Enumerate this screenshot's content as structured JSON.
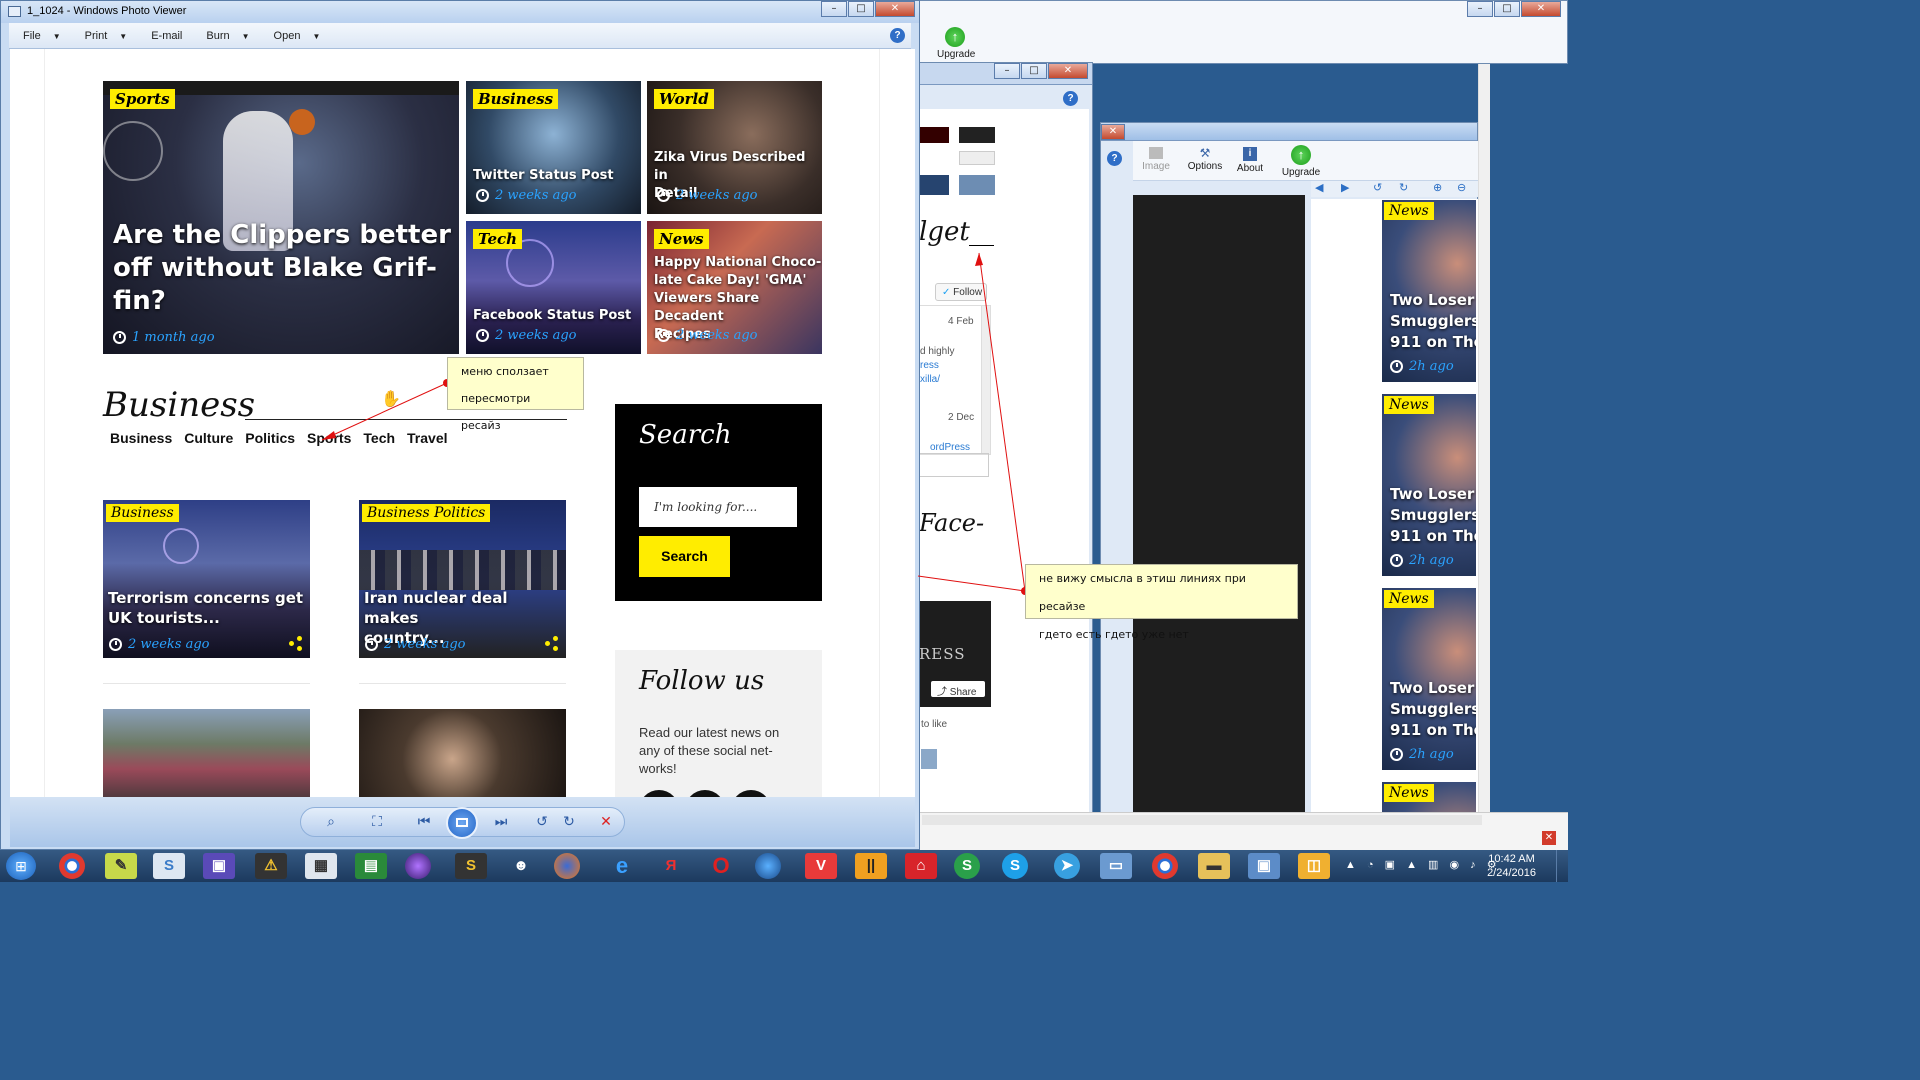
{
  "viewer": {
    "window_title": "1_1024 - Windows Photo Viewer",
    "menu": [
      {
        "label": "File"
      },
      {
        "label": "Print"
      },
      {
        "label": "E-mail"
      },
      {
        "label": "Burn"
      },
      {
        "label": "Open"
      }
    ]
  },
  "page": {
    "featured": {
      "tag": "Sports",
      "title_lines": [
        "Are the Clippers better",
        "off without Blake Grif-",
        "fin?"
      ],
      "time": "1 month ago"
    },
    "tiles": [
      {
        "tag": "Business",
        "title_lines": [
          "Twitter Status Post"
        ],
        "time": "2 weeks ago"
      },
      {
        "tag": "World",
        "title_lines": [
          "Zika Virus Described in",
          "Detail"
        ],
        "time": "2 weeks ago"
      },
      {
        "tag": "Tech",
        "title_lines": [
          "Facebook Status Post"
        ],
        "time": "2 weeks ago"
      },
      {
        "tag": "News",
        "title_lines": [
          "Happy National Choco-",
          "late Cake Day! 'GMA'",
          "Viewers Share Decadent",
          "Recipes"
        ],
        "time": "2 weeks ago"
      }
    ],
    "business_section": {
      "title": "Business",
      "nav": [
        "Business",
        "Culture",
        "Politics",
        "Sports",
        "Tech",
        "Travel"
      ]
    },
    "cards": [
      {
        "tags": [
          "Business"
        ],
        "title_lines": [
          "Terrorism concerns get",
          "UK tourists..."
        ],
        "time": "2 weeks ago"
      },
      {
        "tags": [
          "Business",
          "Politics"
        ],
        "title_lines": [
          "Iran nuclear deal makes",
          "country..."
        ],
        "time": "2 weeks ago"
      }
    ],
    "search": {
      "title": "Search",
      "placeholder": "I'm looking for....",
      "button": "Search"
    },
    "follow": {
      "title": "Follow us",
      "text_lines": [
        "Read our latest news on",
        "any of these social net-",
        "works!"
      ]
    }
  },
  "notes": {
    "note1_lines": [
      "меню сползает",
      "пересмотри ресайз"
    ],
    "note2_lines": [
      "не вижу смысла в этиш линиях при ресайзе",
      "гдето есть гдето уже нет"
    ]
  },
  "background_windows": {
    "upgrade_label": "Upgrade",
    "toolbar2": {
      "image": "Image",
      "options": "Options",
      "about": "About",
      "upgrade": "Upgrade"
    },
    "partial_texts": {
      "get": "lget",
      "face": "Face-",
      "follow_btn": "Follow",
      "date1": "4 Feb",
      "date2": "2 Dec",
      "highly": "d highly",
      "ress": "ress",
      "xilla": "xilla/",
      "wordpress": "ordPress",
      "ress_big": "RESS",
      "share": "Share",
      "to_like": "to like"
    },
    "right_cards": [
      {
        "tag": "News",
        "title_lines": [
          "Two Loser",
          "Smugglers",
          "911 on The"
        ],
        "time": "2h ago"
      },
      {
        "tag": "News",
        "title_lines": [
          "Two Loser",
          "Smugglers",
          "911 on The"
        ],
        "time": "2h ago"
      },
      {
        "tag": "News",
        "title_lines": [
          "Two Loser",
          "Smugglers",
          "911 on The"
        ],
        "time": "2h ago"
      },
      {
        "tag": "News",
        "title_lines": [],
        "time": ""
      }
    ]
  },
  "taskbar": {
    "time": "10:42 AM",
    "date": "2/24/2016"
  },
  "colors": {
    "accent_yellow": "#ffed00",
    "time_blue": "#2aa3ff",
    "note_bg": "#ffffcc",
    "annotation_red": "#e01010"
  }
}
